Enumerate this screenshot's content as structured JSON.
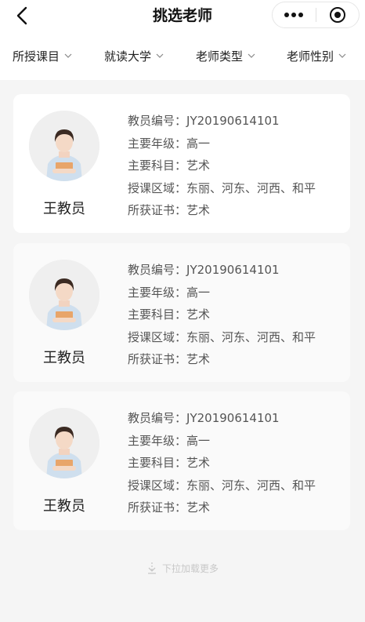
{
  "header": {
    "title": "挑选老师",
    "back_icon": "chevron-left-icon",
    "more_icon": "more-dots-icon",
    "record_icon": "record-target-icon"
  },
  "filters": [
    {
      "label": "所授课目"
    },
    {
      "label": "就读大学"
    },
    {
      "label": "老师类型"
    },
    {
      "label": "老师性别"
    }
  ],
  "teachers": [
    {
      "name": "王教员",
      "fields": [
        {
          "label": "教员编号：",
          "value": "JY20190614101"
        },
        {
          "label": "主要年级：",
          "value": "高一"
        },
        {
          "label": "主要科目：",
          "value": "艺术"
        },
        {
          "label": "授课区域：",
          "value": "东丽、河东、河西、和平"
        },
        {
          "label": "所获证书：",
          "value": "艺术"
        }
      ]
    },
    {
      "name": "王教员",
      "fields": [
        {
          "label": "教员编号：",
          "value": "JY20190614101"
        },
        {
          "label": "主要年级：",
          "value": "高一"
        },
        {
          "label": "主要科目：",
          "value": "艺术"
        },
        {
          "label": "授课区域：",
          "value": "东丽、河东、河西、和平"
        },
        {
          "label": "所获证书：",
          "value": "艺术"
        }
      ]
    },
    {
      "name": "王教员",
      "fields": [
        {
          "label": "教员编号：",
          "value": "JY20190614101"
        },
        {
          "label": "主要年级：",
          "value": "高一"
        },
        {
          "label": "主要科目：",
          "value": "艺术"
        },
        {
          "label": "授课区域：",
          "value": "东丽、河东、河西、和平"
        },
        {
          "label": "所获证书：",
          "value": "艺术"
        }
      ]
    }
  ],
  "footer": {
    "load_more_text": "下拉加载更多",
    "load_more_icon": "arrow-down-icon"
  },
  "colors": {
    "background": "#f5f5f5",
    "card": "#ffffff",
    "text_primary": "#222222",
    "text_secondary": "#555555",
    "hint": "#c8c8c8"
  }
}
